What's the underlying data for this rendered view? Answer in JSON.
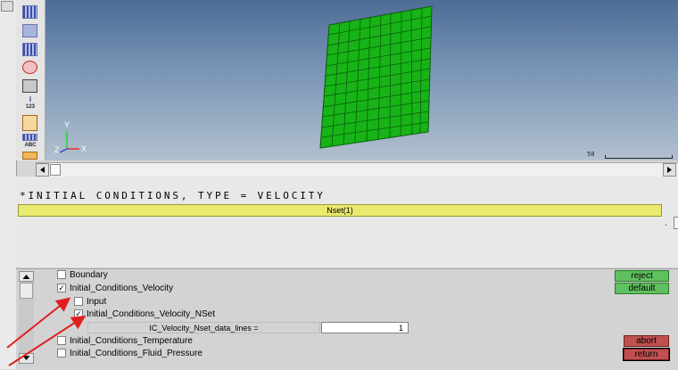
{
  "toolbar": {
    "icons": [
      "mesh-view-icon",
      "shaded-view-icon",
      "element-view-icon",
      "ring-select-icon",
      "window-select-icon",
      "binoculars-icon",
      "info-123-icon",
      "angle-icon",
      "abc-label-icon",
      "color-bar-icon"
    ],
    "info_label": "123",
    "abc_label": "ABC"
  },
  "viewport": {
    "triad": {
      "y": "Y",
      "z": "Z",
      "x": "X"
    },
    "scale_label": "50"
  },
  "card": {
    "keyword": "*INITIAL CONDITIONS, TYPE = VELOCITY",
    "nset_label": "Nset(1)",
    "dot": "."
  },
  "tree": {
    "items": [
      {
        "label": "Boundary",
        "checked": false
      },
      {
        "label": "Initial_Conditions_Velocity",
        "checked": true
      },
      {
        "label": "Input",
        "checked": false
      },
      {
        "label": "Initial_Conditions_Velocity_NSet",
        "checked": true
      },
      {
        "label": "Initial_Conditions_Temperature",
        "checked": false
      },
      {
        "label": "Initial_Conditions_Fluid_Pressure",
        "checked": false
      }
    ],
    "field": {
      "label": "IC_Velocity_Nset_data_lines =",
      "value": "1"
    },
    "check_mark": "✓"
  },
  "buttons": {
    "reject": "reject",
    "default": "default",
    "abort": "abort",
    "return": "return"
  },
  "colors": {
    "mesh_fill": "#17b317",
    "mesh_line": "#0b5e0b",
    "nset_bar": "#e9ea70",
    "green_button": "#60c060",
    "red_button": "#c05050",
    "annotation_arrow": "#e02020"
  }
}
